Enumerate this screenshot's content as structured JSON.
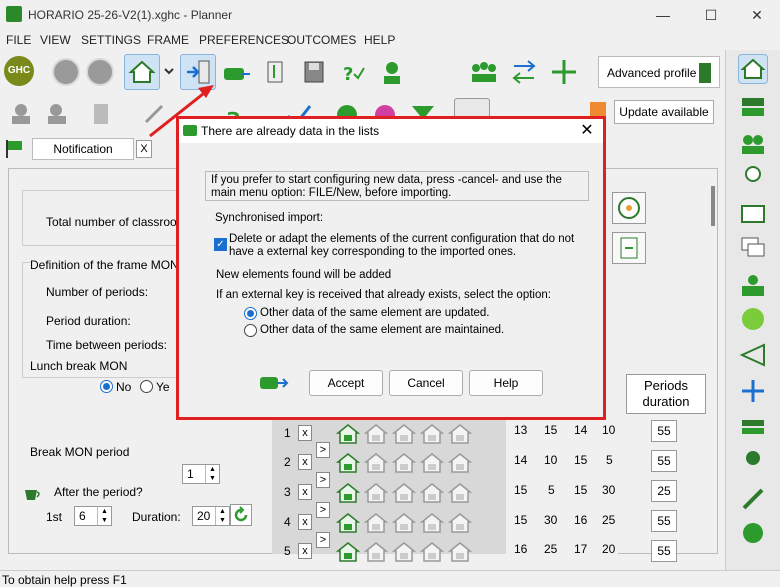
{
  "window": {
    "title": "HORARIO 25-26-V2(1).xghc - Planner",
    "minimize": "—",
    "maximize": "☐",
    "close": "✕"
  },
  "menu": [
    "FILE",
    "VIEW",
    "SETTINGS",
    "FRAME",
    "PREFERENCES",
    "OUTCOMES",
    "HELP"
  ],
  "toolbar": {
    "ghc_label": "GHC",
    "advanced_profile": "Advanced profile",
    "update_available": "Update available"
  },
  "tabs": {
    "notification": "Notification",
    "close": "X"
  },
  "form": {
    "total_classrooms": "Total number of classroom",
    "definition_frame": "Definition of the frame  MON",
    "num_periods": "Number of periods:",
    "period_duration": "Period duration:",
    "time_between": "Time between periods:",
    "lunch_break": "Lunch break  MON",
    "lunch_no": "No",
    "lunch_yes": "Ye",
    "break_period": "Break  MON period",
    "break_value": "1",
    "after_period": "After the period?",
    "first": "1st",
    "first_value": "6",
    "duration": "Duration:",
    "duration_value": "20"
  },
  "grid": {
    "rows": [
      "1",
      "2",
      "3",
      "4",
      "5"
    ],
    "x_mark": "x",
    "arrow": ">",
    "times": [
      [
        "13",
        "15",
        "14",
        "10"
      ],
      [
        "14",
        "10",
        "15",
        "5"
      ],
      [
        "15",
        "5",
        "15",
        "30"
      ],
      [
        "15",
        "30",
        "16",
        "25"
      ],
      [
        "16",
        "25",
        "17",
        "20"
      ]
    ],
    "periods_header": "Periods duration",
    "durations": [
      "55",
      "55",
      "25",
      "55",
      "55"
    ]
  },
  "dialog": {
    "title": "There are already data in the lists",
    "info": "If you prefer to start configuring new data, press -cancel- and use the main menu option: FILE/New, before importing.",
    "sync_import": "Synchronised import:",
    "checkbox_label_1": "Delete or adapt the elements of the current configuration that do not",
    "checkbox_label_2": "have a external key corresponding to the imported ones.",
    "checkbox_checked": true,
    "new_elements": "New elements found will be added",
    "external_key": "If an external key is received that already exists, select the option:",
    "option_updated": "Other data of the same element are updated.",
    "option_maintained": "Other data of the same element are maintained.",
    "selected_option": "updated",
    "accept": "Accept",
    "cancel": "Cancel",
    "help": "Help"
  },
  "status": {
    "text": "To obtain help press F1"
  },
  "colors": {
    "accent_red": "#e02020",
    "accent_blue": "#1a6fd0",
    "accent_green": "#2d9a2d"
  }
}
